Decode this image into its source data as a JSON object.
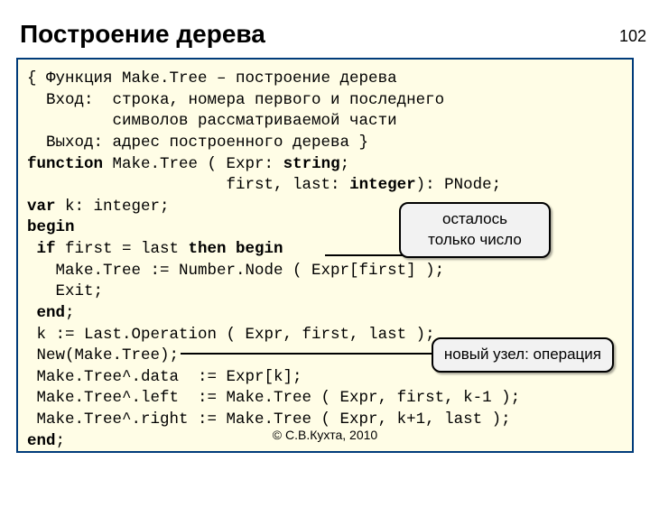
{
  "page_number": "102",
  "title": "Построение дерева",
  "code": {
    "l01": "{ Функция Make.Tree – построение дерева",
    "l02": "  Вход:  строка, номера первого и последнего",
    "l03": "         символов рассматриваемой части",
    "l04": "  Выход: адрес построенного дерева }",
    "l05a": "function",
    "l05b": " Make.Tree ( Expr: ",
    "l05c": "string",
    "l05d": ";",
    "l06a": "                     first, last: ",
    "l06b": "integer",
    "l06c": "): PNode;",
    "l07a": "var",
    "l07b": " k: integer;",
    "l08": "begin",
    "l09a": " if",
    "l09b": " first = last ",
    "l09c": "then begin",
    "l10": "   Make.Tree := Number.Node ( Expr[first] );",
    "l11": "   Exit;",
    "l12a": " end",
    "l12b": ";",
    "l13": " k := Last.Operation ( Expr, first, last );",
    "l14": " New(Make.Tree);",
    "l15": " Make.Tree^.data  := Expr[k];",
    "l16": " Make.Tree^.left  := Make.Tree ( Expr, first, k-1 );",
    "l17": " Make.Tree^.right := Make.Tree ( Expr, k+1, last );",
    "l18a": "end",
    "l18b": ";"
  },
  "callouts": {
    "c1_line1": "осталось",
    "c1_line2": "только число",
    "c2": "новый узел: операция"
  },
  "copyright": "© С.В.Кухта, 2010"
}
